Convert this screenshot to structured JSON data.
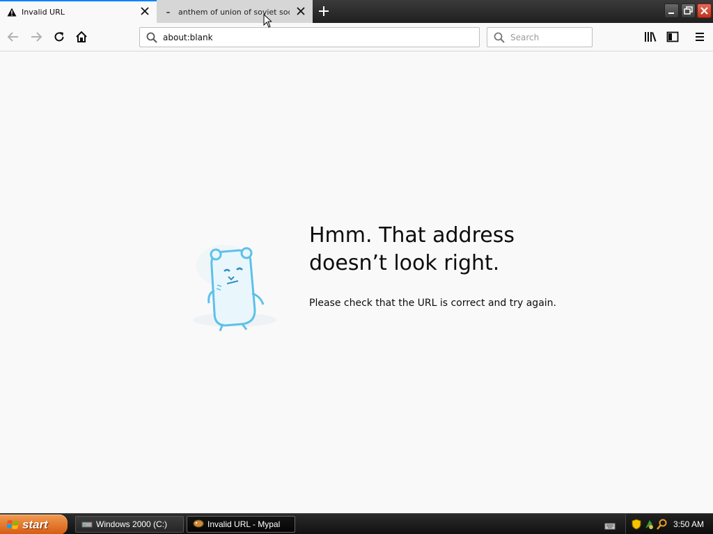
{
  "window": {
    "tabs": [
      {
        "title": "Invalid URL",
        "icon": "warning-icon",
        "active": true
      },
      {
        "title": "anthem of union of soviet socialist",
        "icon": "loading-dot-icon",
        "active": false
      }
    ],
    "new_tab_icon": "plus-icon",
    "controls": [
      "minimize-icon",
      "restore-icon",
      "close-icon"
    ]
  },
  "navbar": {
    "back_icon": "back-arrow-icon",
    "forward_icon": "forward-arrow-icon",
    "reload_icon": "reload-icon",
    "home_icon": "home-icon",
    "url": "about:blank",
    "search_placeholder": "Search",
    "library_icon": "library-icon",
    "sidebar_icon": "sidebar-icon",
    "menu_icon": "hamburger-menu-icon"
  },
  "error_page": {
    "title_line1": "Hmm. That address",
    "title_line2": "doesn’t look right.",
    "description": "Please check that the URL is correct and try again.",
    "accent_color": "#5dc0ea"
  },
  "taskbar": {
    "start_label": "start",
    "items": [
      {
        "label": "Windows 2000 (C:)",
        "icon": "drive-icon"
      },
      {
        "label": "Invalid URL - Mypal",
        "icon": "mypal-icon"
      }
    ],
    "clock": "3:50 AM",
    "start_color": "#e0742b"
  }
}
